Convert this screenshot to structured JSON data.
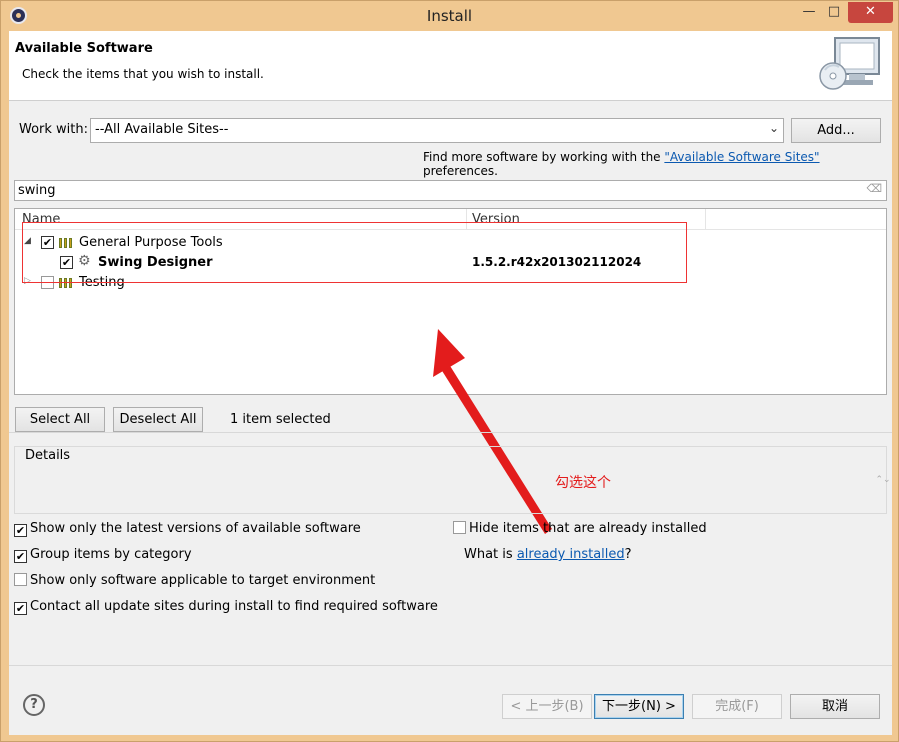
{
  "window": {
    "title": "Install",
    "minimize": "—",
    "maximize": "□",
    "close": "✕"
  },
  "banner": {
    "title": "Available Software",
    "subtitle": "Check the items that you wish to install."
  },
  "work_with": {
    "label": "Work with:",
    "value": "--All Available Sites--",
    "add_button": "Add..."
  },
  "more_software": {
    "prefix": "Find more software by working with the ",
    "link": "\"Available Software Sites\"",
    "suffix": " preferences."
  },
  "filter": {
    "value": "swing"
  },
  "tree": {
    "columns": [
      "Name",
      "Version"
    ],
    "rows": [
      {
        "name": "General Purpose Tools",
        "version": "",
        "checked": true,
        "expanded": true
      },
      {
        "name": "Swing Designer",
        "version": "1.5.2.r42x201302112024",
        "checked": true
      },
      {
        "name": "Testing",
        "version": "",
        "checked": false,
        "expanded": false
      }
    ]
  },
  "selection": {
    "select_all": "Select All",
    "deselect_all": "Deselect All",
    "status": "1 item selected"
  },
  "details": {
    "title": "Details"
  },
  "annotation": {
    "text": "勾选这个",
    "color": "#e31c1c"
  },
  "options": {
    "latest": {
      "label": "Show only the latest versions of available software",
      "checked": true
    },
    "group": {
      "label": "Group items by category",
      "checked": true
    },
    "target": {
      "label": "Show only software applicable to target environment",
      "checked": false
    },
    "contact": {
      "label": "Contact all update sites during install to find required software",
      "checked": true
    },
    "hide": {
      "label": "Hide items that are already installed",
      "checked": false
    },
    "what_is_prefix": "What is ",
    "what_is_link": "already installed",
    "what_is_suffix": "?"
  },
  "buttons": {
    "back": "< 上一步(B)",
    "next": "下一步(N) >",
    "finish": "完成(F)",
    "cancel": "取消"
  },
  "icons": {
    "help": "?",
    "check": "✔",
    "expanded": "◢",
    "collapsed": "▷",
    "dropdown": "⌄",
    "clear": "⌫",
    "spinner": "⌃⌄"
  }
}
